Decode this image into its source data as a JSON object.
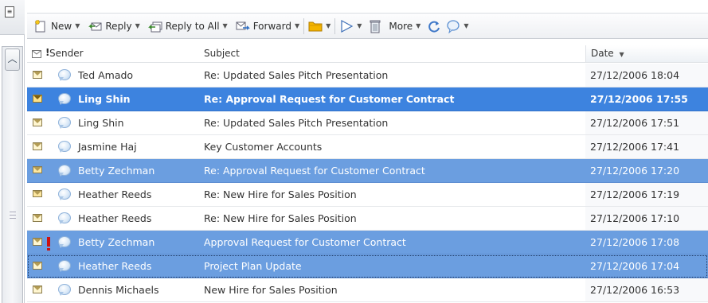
{
  "toolbar": {
    "new_label": "New",
    "reply_label": "Reply",
    "reply_all_label": "Reply to All",
    "forward_label": "Forward",
    "more_label": "More"
  },
  "columns": {
    "sender": "Sender",
    "subject": "Subject",
    "date": "Date"
  },
  "messages": [
    {
      "sender": "Ted Amado",
      "subject": "Re: Updated Sales Pitch Presentation",
      "date": "27/12/2006 18:04",
      "state": "normal",
      "icon": "envelope-read"
    },
    {
      "sender": "Ling Shin",
      "subject": "Re: Approval Request for Customer Contract",
      "date": "27/12/2006 17:55",
      "state": "selected-unread",
      "icon": "envelope-unread"
    },
    {
      "sender": "Ling Shin",
      "subject": "Re: Updated Sales Pitch Presentation",
      "date": "27/12/2006 17:51",
      "state": "normal",
      "icon": "envelope-read"
    },
    {
      "sender": "Jasmine Haj",
      "subject": "Key Customer Accounts",
      "date": "27/12/2006 17:41",
      "state": "normal",
      "icon": "envelope-read"
    },
    {
      "sender": "Betty Zechman",
      "subject": "Re: Approval Request for Customer Contract",
      "date": "27/12/2006 17:20",
      "state": "selected",
      "icon": "envelope-replied"
    },
    {
      "sender": "Heather Reeds",
      "subject": "Re: New Hire for Sales Position",
      "date": "27/12/2006 17:19",
      "state": "normal",
      "icon": "envelope-replied"
    },
    {
      "sender": "Heather Reeds",
      "subject": "Re: New Hire for Sales Position",
      "date": "27/12/2006 17:10",
      "state": "normal",
      "icon": "envelope-read"
    },
    {
      "sender": "Betty Zechman",
      "subject": "Approval Request for Customer Contract",
      "date": "27/12/2006 17:08",
      "state": "selected",
      "icon": "envelope-read",
      "flag": "high-priority"
    },
    {
      "sender": "Heather Reeds",
      "subject": "Project Plan Update",
      "date": "27/12/2006 17:04",
      "state": "selected-focus",
      "icon": "envelope-read"
    },
    {
      "sender": "Dennis Michaels",
      "subject": "New Hire for Sales Position",
      "date": "27/12/2006 16:53",
      "state": "normal",
      "icon": "envelope-read"
    }
  ],
  "colors": {
    "selection": "#6b9ee0",
    "selection_strong": "#3d83df",
    "priority_flag": "#cc1111"
  }
}
